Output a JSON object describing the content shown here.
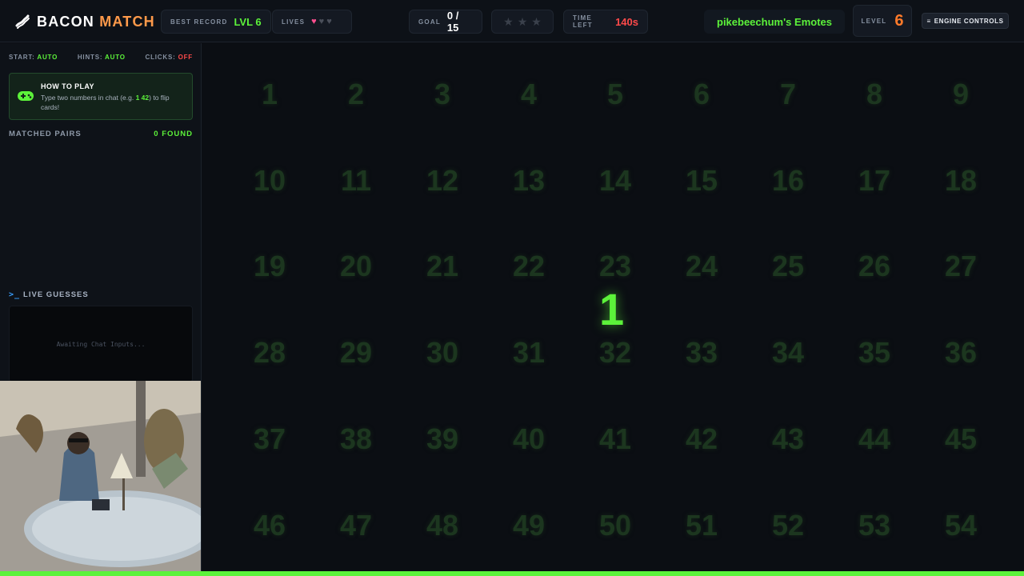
{
  "header": {
    "logo_word1": "BACON",
    "logo_word2": "MATCH",
    "best_record": {
      "label": "BEST RECORD",
      "value": "LVL 6"
    },
    "lives": {
      "label": "LIVES",
      "full": 1,
      "total": 3
    },
    "goal": {
      "label": "GOAL",
      "value": "0 / 15"
    },
    "stars": {
      "earned": 0,
      "total": 3
    },
    "time_left": {
      "label": "TIME LEFT",
      "value": "140s"
    },
    "emotes": "pikebeechum's Emotes",
    "level": {
      "label": "LEVEL",
      "value": "6"
    },
    "engine_controls": "ENGINE CONTROLS"
  },
  "sidebar": {
    "settings": [
      {
        "label": "START:",
        "value": "AUTO",
        "color": "#5cf23a"
      },
      {
        "label": "HINTS:",
        "value": "AUTO",
        "color": "#5cf23a"
      },
      {
        "label": "CLICKS:",
        "value": "OFF",
        "color": "#ff4a4a"
      }
    ],
    "how_to_play": {
      "title": "HOW TO PLAY",
      "text_before": "Type two numbers in chat (e.g. ",
      "example": "1 42",
      "text_after": ") to flip cards!"
    },
    "matched_pairs": {
      "label": "MATCHED PAIRS",
      "count": "0 FOUND"
    },
    "live_guesses": {
      "label": "LIVE GUESSES",
      "placeholder": "Awaiting Chat Inputs..."
    }
  },
  "board": {
    "cells": [
      "1",
      "2",
      "3",
      "4",
      "5",
      "6",
      "7",
      "8",
      "9",
      "10",
      "11",
      "12",
      "13",
      "14",
      "15",
      "16",
      "17",
      "18",
      "19",
      "20",
      "21",
      "22",
      "23",
      "24",
      "25",
      "26",
      "27",
      "28",
      "29",
      "30",
      "31",
      "32",
      "33",
      "34",
      "35",
      "36",
      "37",
      "38",
      "39",
      "40",
      "41",
      "42",
      "43",
      "44",
      "45",
      "46",
      "47",
      "48",
      "49",
      "50",
      "51",
      "52",
      "53",
      "54"
    ],
    "flipped_value": "1"
  },
  "colors": {
    "accent_green": "#5cf23a",
    "accent_orange": "#ff7a2a",
    "alert_red": "#ff4a4a",
    "background": "#0b0e13"
  }
}
